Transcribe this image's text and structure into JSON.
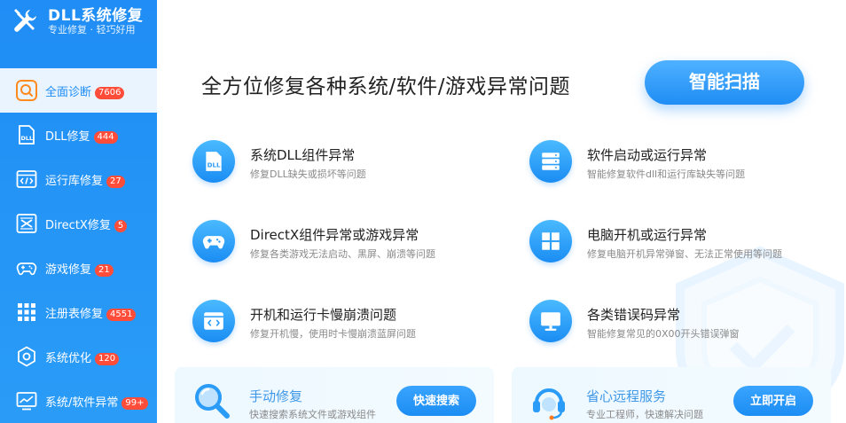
{
  "brand": {
    "title": "DLL系统修复",
    "subtitle": "专业修复 · 轻巧好用"
  },
  "sidebar": {
    "items": [
      {
        "label": "全面诊断",
        "badge": "7606",
        "icon": "search-icon",
        "active": true
      },
      {
        "label": "DLL修复",
        "badge": "444",
        "icon": "dll-file-icon"
      },
      {
        "label": "运行库修复",
        "badge": "27",
        "icon": "code-window-icon"
      },
      {
        "label": "DirectX修复",
        "badge": "5",
        "icon": "directx-icon"
      },
      {
        "label": "游戏修复",
        "badge": "21",
        "icon": "gamepad-icon"
      },
      {
        "label": "注册表修复",
        "badge": "4551",
        "icon": "grid-icon"
      },
      {
        "label": "系统优化",
        "badge": "120",
        "icon": "gear-icon"
      },
      {
        "label": "系统/软件异常",
        "badge": "99+",
        "icon": "monitor-chart-icon"
      }
    ]
  },
  "main": {
    "headline": "全方位修复各种系统/软件/游戏异常问题",
    "scan_button": "智能扫描",
    "features": [
      {
        "title": "系统DLL组件异常",
        "desc": "修复DLL缺失或损坏等问题",
        "icon": "dll-file-icon"
      },
      {
        "title": "软件启动或运行异常",
        "desc": "智能修复软件dll和运行库缺失等问题",
        "icon": "server-stack-icon"
      },
      {
        "title": "DirectX组件异常或游戏异常",
        "desc": "修复各类游戏无法启动、黑屏、崩溃等问题",
        "icon": "gamepad-icon"
      },
      {
        "title": "电脑开机或运行异常",
        "desc": "修复电脑开机异常弹窗、无法正常使用等问题",
        "icon": "windows-icon"
      },
      {
        "title": "开机和运行卡慢崩溃问题",
        "desc": "修复开机慢，使用时卡慢崩溃蓝屏问题",
        "icon": "code-window-icon"
      },
      {
        "title": "各类错误码异常",
        "desc": "智能修复常见的0X00开头错误弹窗",
        "icon": "monitor-icon"
      }
    ],
    "cards": [
      {
        "title": "手动修复",
        "desc": "快速搜索系统文件或游戏组件",
        "button": "快速搜索",
        "icon": "magnifier-icon"
      },
      {
        "title": "省心远程服务",
        "desc": "专业工程师，快速解决问题",
        "button": "立即开启",
        "icon": "headset-icon"
      }
    ]
  },
  "colors": {
    "accent": "#1f8df5",
    "badge": "#ff4d3a"
  }
}
